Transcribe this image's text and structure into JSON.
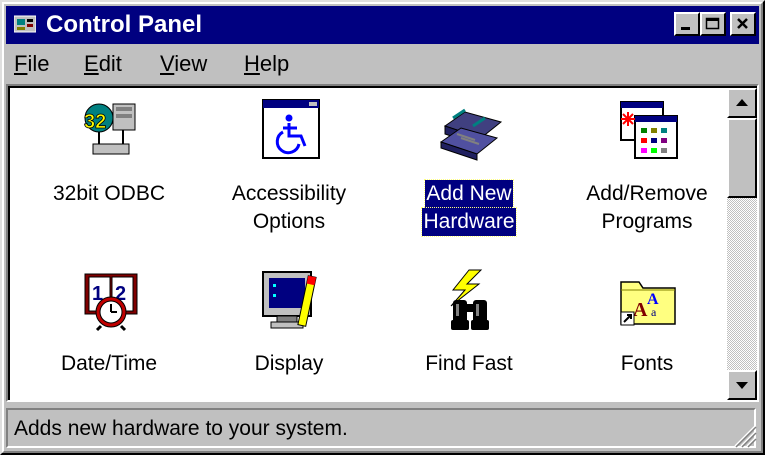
{
  "window": {
    "title": "Control Panel",
    "icon": "control-panel-icon"
  },
  "title_buttons": [
    "minimize-icon",
    "maximize-icon",
    "close-icon"
  ],
  "menu": [
    {
      "label": "File",
      "mnemonic": "F",
      "rest": "ile"
    },
    {
      "label": "Edit",
      "mnemonic": "E",
      "rest": "dit"
    },
    {
      "label": "View",
      "mnemonic": "V",
      "rest": "iew"
    },
    {
      "label": "Help",
      "mnemonic": "H",
      "rest": "elp"
    }
  ],
  "items": [
    {
      "line1": "32bit ODBC",
      "line2": "",
      "icon": "odbc-icon",
      "selected": false
    },
    {
      "line1": "Accessibility",
      "line2": "Options",
      "icon": "accessibility-icon",
      "selected": false
    },
    {
      "line1": "Add New",
      "line2": "Hardware",
      "icon": "add-hardware-icon",
      "selected": true
    },
    {
      "line1": "Add/Remove",
      "line2": "Programs",
      "icon": "add-remove-programs-icon",
      "selected": false
    },
    {
      "line1": "Date/Time",
      "line2": "",
      "icon": "date-time-icon",
      "selected": false
    },
    {
      "line1": "Display",
      "line2": "",
      "icon": "display-icon",
      "selected": false
    },
    {
      "line1": "Find Fast",
      "line2": "",
      "icon": "find-fast-icon",
      "selected": false
    },
    {
      "line1": "Fonts",
      "line2": "",
      "icon": "fonts-icon",
      "selected": false
    }
  ],
  "status": {
    "text": "Adds new hardware to your system."
  },
  "colors": {
    "titlebar": "#000080",
    "face": "#c0c0c0",
    "selection": "#000080"
  }
}
